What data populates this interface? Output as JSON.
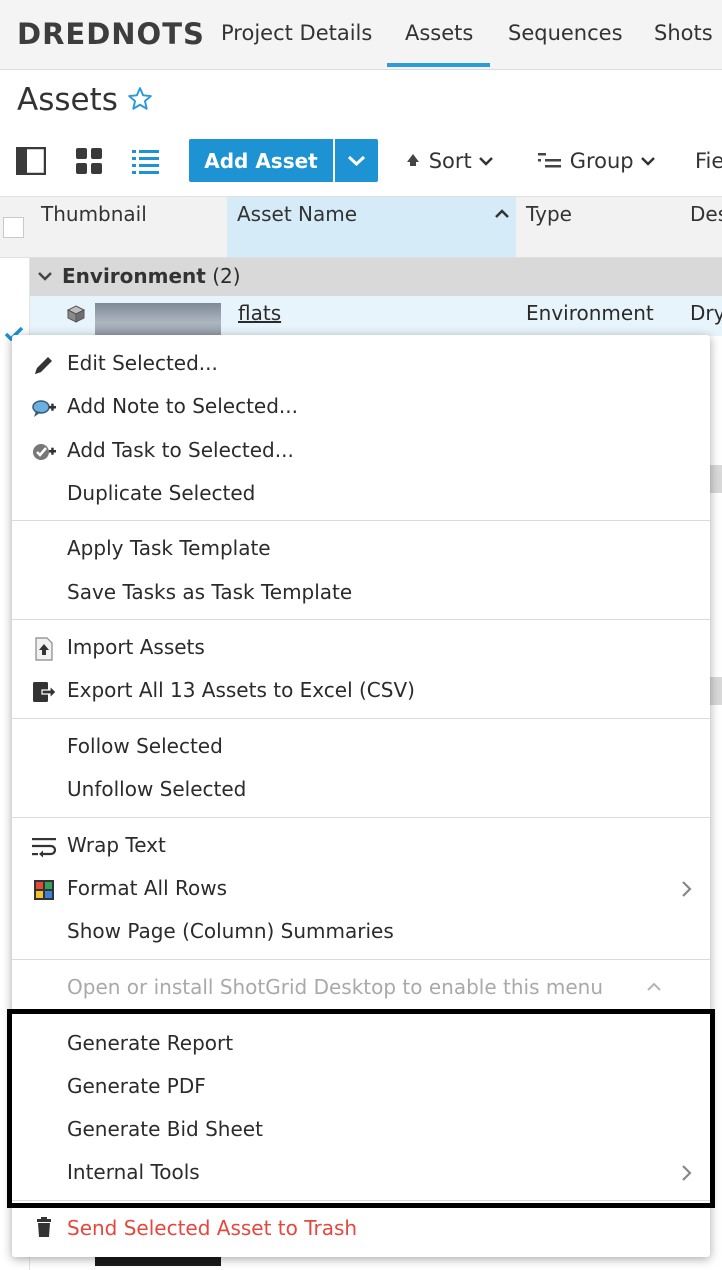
{
  "nav": {
    "brand": "DREDNOTS",
    "tabs": [
      "Project Details",
      "Assets",
      "Sequences",
      "Shots"
    ],
    "active_tab": "Assets"
  },
  "page": {
    "title": "Assets"
  },
  "toolbar": {
    "add_asset": "Add Asset",
    "sort": "Sort",
    "group": "Group",
    "fields_partial": "Fie"
  },
  "grid": {
    "columns": [
      "Thumbnail",
      "Asset Name",
      "Type",
      "Des"
    ],
    "sorted_column": "Asset Name",
    "group": {
      "name": "Environment",
      "count": "(2)"
    },
    "row": {
      "asset_name": "flats",
      "type": "Environment",
      "description_partial": "Dry"
    }
  },
  "context_menu": {
    "edit_selected": "Edit Selected...",
    "add_note": "Add Note to Selected...",
    "add_task": "Add Task to Selected...",
    "duplicate": "Duplicate Selected",
    "apply_template": "Apply Task Template",
    "save_template": "Save Tasks as Task Template",
    "import_assets": "Import Assets",
    "export_assets": "Export All 13 Assets to Excel (CSV)",
    "follow": "Follow Selected",
    "unfollow": "Unfollow Selected",
    "wrap_text": "Wrap Text",
    "format_rows": "Format All Rows",
    "show_summaries": "Show Page (Column) Summaries",
    "desktop_notice": "Open or install ShotGrid Desktop to enable this menu",
    "generate_report": "Generate Report",
    "generate_pdf": "Generate PDF",
    "generate_bid": "Generate Bid Sheet",
    "internal_tools": "Internal Tools",
    "trash": "Send Selected Asset to Trash"
  },
  "colors": {
    "accent": "#1d93d4",
    "danger": "#e5473d",
    "sorted_header": "#d5ebf8"
  }
}
